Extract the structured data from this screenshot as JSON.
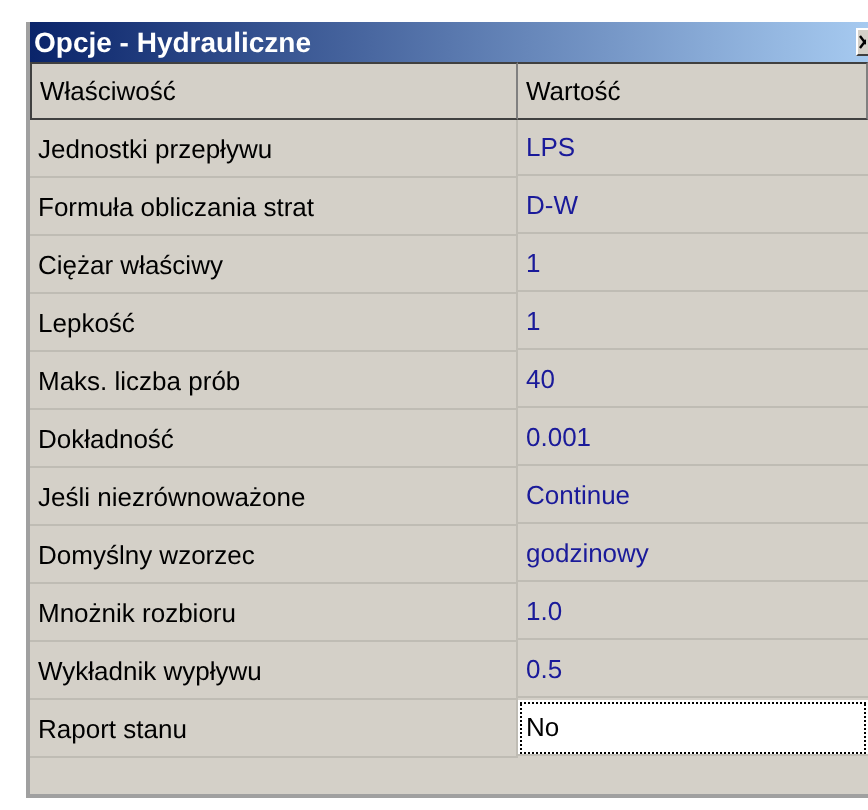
{
  "window": {
    "title": "Opcje - Hydrauliczne"
  },
  "table": {
    "columns": [
      "Właściwość",
      "Wartość"
    ],
    "rows": [
      {
        "property": "Jednostki przepływu",
        "value": "LPS",
        "selected": false
      },
      {
        "property": "Formuła obliczania strat",
        "value": "D-W",
        "selected": false
      },
      {
        "property": "Ciężar właściwy",
        "value": "1",
        "selected": false
      },
      {
        "property": "Lepkość",
        "value": "1",
        "selected": false
      },
      {
        "property": "Maks. liczba prób",
        "value": "40",
        "selected": false
      },
      {
        "property": "Dokładność",
        "value": "0.001",
        "selected": false
      },
      {
        "property": "Jeśli niezrównoważone",
        "value": "Continue",
        "selected": false
      },
      {
        "property": "Domyślny wzorzec",
        "value": "godzinowy",
        "selected": false
      },
      {
        "property": "Mnożnik rozbioru",
        "value": "1.0",
        "selected": false
      },
      {
        "property": "Wykładnik wypływu",
        "value": "0.5",
        "selected": false
      },
      {
        "property": "Raport stanu",
        "value": "No",
        "selected": true
      }
    ]
  }
}
